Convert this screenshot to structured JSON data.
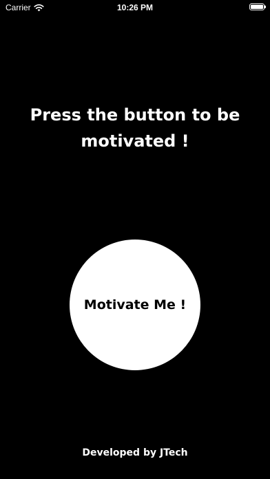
{
  "status_bar": {
    "carrier": "Carrier",
    "time": "10:26 PM"
  },
  "main": {
    "headline": "Press the button to be motivated !",
    "button_label": "Motivate Me !"
  },
  "footer": {
    "credit": "Developed by JTech"
  },
  "colors": {
    "background": "#000000",
    "text": "#ffffff",
    "button_background": "#ffffff",
    "button_text": "#000000"
  },
  "icons": [
    "wifi-icon",
    "battery-icon"
  ]
}
